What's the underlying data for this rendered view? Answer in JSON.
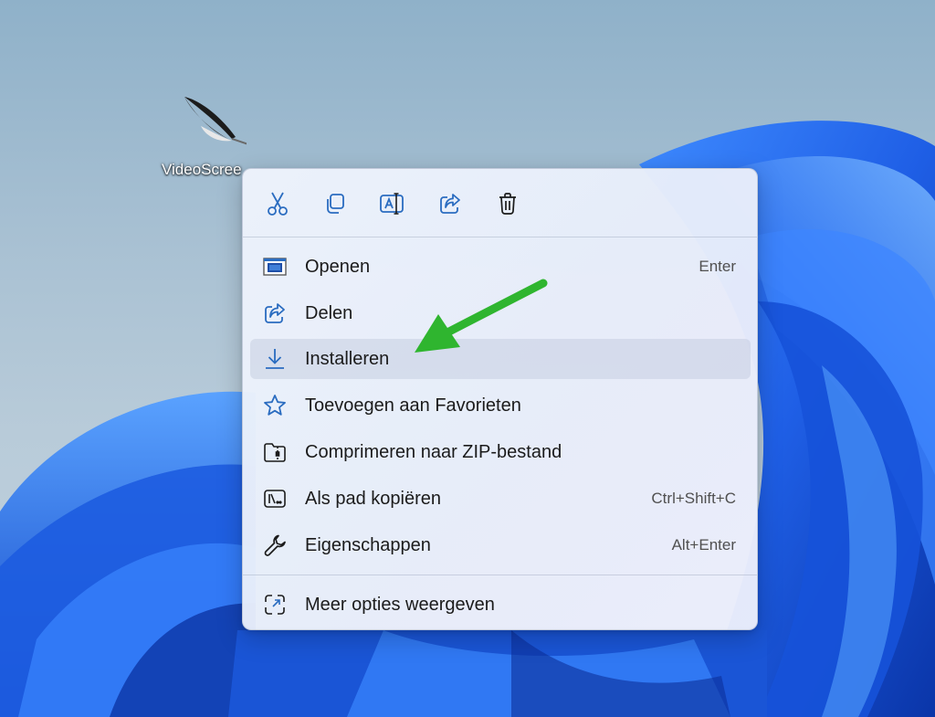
{
  "desktop": {
    "icon": {
      "label": "VideoScree",
      "icon_name": "quill-feather-icon"
    }
  },
  "context_menu": {
    "toolbar": [
      {
        "name": "cut",
        "icon": "scissors-icon",
        "tooltip": "Knippen"
      },
      {
        "name": "copy",
        "icon": "copy-icon",
        "tooltip": "Kopiëren"
      },
      {
        "name": "rename",
        "icon": "rename-icon",
        "tooltip": "Naam wijzigen"
      },
      {
        "name": "share",
        "icon": "share-icon",
        "tooltip": "Delen"
      },
      {
        "name": "delete",
        "icon": "trash-icon",
        "tooltip": "Verwijderen"
      }
    ],
    "items": [
      {
        "label": "Openen",
        "shortcut": "Enter",
        "icon": "app-window-icon"
      },
      {
        "label": "Delen",
        "shortcut": "",
        "icon": "share-icon"
      },
      {
        "label": "Installeren",
        "shortcut": "",
        "icon": "download-icon"
      },
      {
        "label": "Toevoegen aan Favorieten",
        "shortcut": "",
        "icon": "star-icon"
      },
      {
        "label": "Comprimeren naar ZIP-bestand",
        "shortcut": "",
        "icon": "zip-folder-icon"
      },
      {
        "label": "Als pad kopiëren",
        "shortcut": "Ctrl+Shift+C",
        "icon": "copy-path-icon"
      },
      {
        "label": "Eigenschappen",
        "shortcut": "Alt+Enter",
        "icon": "wrench-icon"
      }
    ],
    "more_options": {
      "label": "Meer opties weergeven",
      "icon": "more-options-icon"
    }
  },
  "annotation": {
    "arrow_color": "#2fb52f",
    "points_to": "Installeren"
  },
  "colors": {
    "icon_blue": "#2a6cc0",
    "wallpaper_blue": "#1f5fe6",
    "sky": "#9db8cc"
  }
}
